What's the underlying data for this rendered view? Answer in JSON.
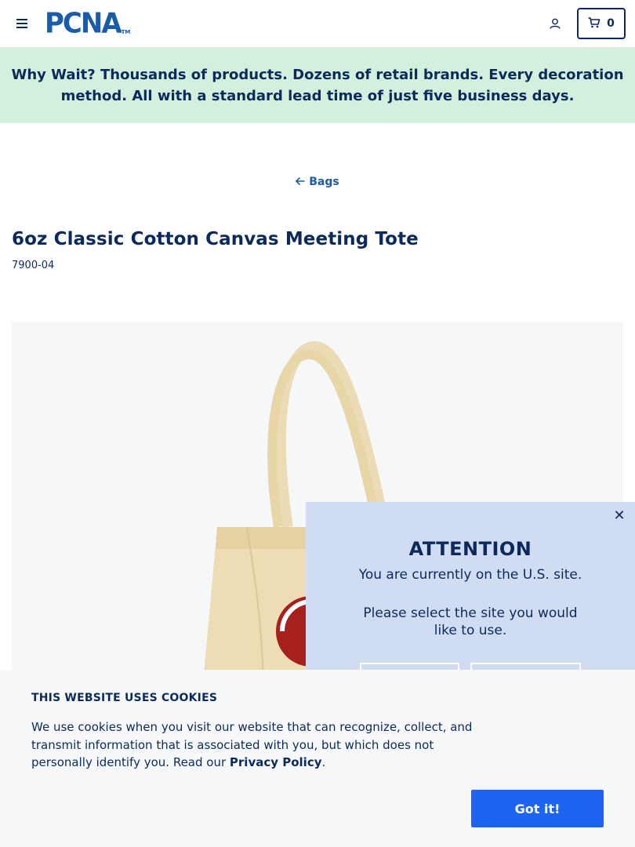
{
  "header": {
    "logo_text": "PCNA",
    "logo_tm": "TM",
    "cart_count": "0",
    "icons": {
      "menu": "menu-icon",
      "account": "user-icon",
      "cart": "cart-icon"
    }
  },
  "promo": {
    "lead": "Why Wait?",
    "text": " Thousands of products. Dozens of retail brands. Every decoration method. All with a standard lead time of just five business days."
  },
  "breadcrumb": {
    "label": "Bags",
    "icon": "arrow-left-icon"
  },
  "product": {
    "title": "6oz Classic Cotton Canvas Meeting Tote",
    "sku": "7900-04"
  },
  "attention": {
    "title": "ATTENTION",
    "line1": "You are currently on the U.S. site.",
    "line2": "Please select the site you would like to use."
  },
  "cookie": {
    "title": "THIS WEBSITE USES COOKIES",
    "text": "We use cookies when you visit our website that can recognize, collect, and transmit information that is associated with you, but which does not personally identify you. Read our ",
    "link": "Privacy Policy",
    "text_end": ".",
    "button": "Got it!"
  },
  "colors": {
    "navy": "#0b2a5b",
    "brand_blue": "#1b5ca8",
    "promo_bg": "#d3f0df",
    "modal_bg": "#cfdcf2",
    "button_blue": "#1c64f2"
  }
}
